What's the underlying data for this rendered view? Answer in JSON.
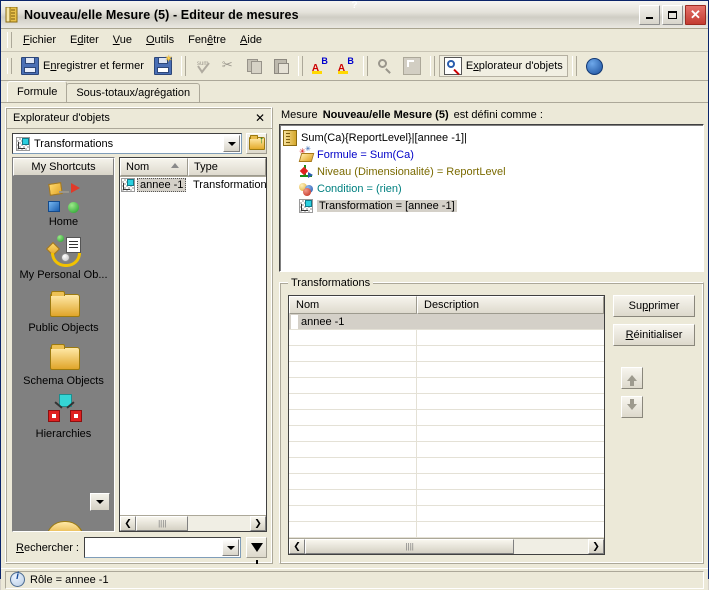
{
  "window": {
    "title": "Nouveau/elle Mesure (5) - Editeur de mesures",
    "icon": "measure-ruler-icon",
    "minimize_label": "–",
    "maximize_label": "□",
    "close_label": "✕"
  },
  "menu": {
    "items": [
      {
        "label": "Fichier",
        "accel": "F"
      },
      {
        "label": "Editer",
        "accel": "d"
      },
      {
        "label": "Vue",
        "accel": "V"
      },
      {
        "label": "Outils",
        "accel": "O"
      },
      {
        "label": "Fenêtre",
        "accel": "ê"
      },
      {
        "label": "Aide",
        "accel": "A"
      }
    ]
  },
  "toolbar": {
    "save_close_label": "Enregistrer et fermer",
    "save_close_accel": "n",
    "object_explorer_label": "Explorateur d'objets",
    "object_explorer_accel": "x",
    "icons": [
      "save-disk-icon",
      "save-as-disk-icon",
      "sum-check-icon",
      "cut-scissors-icon",
      "copy-icon",
      "paste-icon",
      "spell-check-a-icon",
      "spell-check-b-icon",
      "find-icon",
      "zoom-box-icon",
      "object-explorer-icon",
      "help-icon"
    ]
  },
  "tabs": [
    {
      "label": "Formule",
      "active": true
    },
    {
      "label": "Sous-totaux/agrégation",
      "active": false
    }
  ],
  "object_explorer": {
    "panel_title": "Explorateur d'objets",
    "close_label": "✕",
    "combo_value": "Transformations",
    "combo_icon": "transformation-icon",
    "up_button_icon": "folder-up-icon",
    "shortcuts_header": "My Shortcuts",
    "shortcuts": [
      {
        "label": "Home",
        "icon": "home-shapes-icon"
      },
      {
        "label": "My Personal Ob...",
        "icon": "personal-objects-icon"
      },
      {
        "label": "Public Objects",
        "icon": "folder-icon"
      },
      {
        "label": "Schema Objects",
        "icon": "folder-icon"
      },
      {
        "label": "Hierarchies",
        "icon": "hierarchy-icon"
      }
    ],
    "shortcuts_scroll_down": "▼",
    "list": {
      "columns": [
        "Nom",
        "Type"
      ],
      "sort_column": "Nom",
      "sort_direction": "asc",
      "rows": [
        {
          "nom": "annee -1",
          "type": "Transformation",
          "icon": "transformation-icon",
          "selected": true
        }
      ]
    },
    "scroll_left_label": "❮",
    "scroll_right_label": "❯",
    "search_label": "Rechercher :",
    "search_accel": "R",
    "search_value": "",
    "filter_icon": "funnel-filter-icon"
  },
  "measure": {
    "prefix": "Mesure",
    "name": "Nouveau/elle Mesure (5)",
    "suffix": "est défini comme :",
    "tree": {
      "root": {
        "label": "Sum(Ca){ReportLevel}|[annee -1]|",
        "icon": "measure-ruler-icon"
      },
      "children": [
        {
          "label": "Formule = Sum(Ca)",
          "icon": "formula-icon",
          "color": "#0000c8",
          "selected": false
        },
        {
          "label": "Niveau (Dimensionalité) = ReportLevel",
          "icon": "level-axes-icon",
          "color": "#7a6a00",
          "selected": false
        },
        {
          "label": "Condition = (rien)",
          "icon": "condition-spheres-icon",
          "color": "#008080",
          "selected": false
        },
        {
          "label": "Transformation = [annee -1]",
          "icon": "transformation-icon",
          "color": "#000000",
          "selected": true
        }
      ]
    }
  },
  "transformations": {
    "group_title": "Transformations",
    "columns": [
      "Nom",
      "Description"
    ],
    "rows": [
      {
        "nom": "annee -1",
        "description": "",
        "selected": true
      }
    ],
    "empty_rows": 13,
    "delete_button": "Supprimer",
    "delete_accel": "p",
    "reset_button": "Réinitialiser",
    "reset_accel": "R",
    "move_up_icon": "arrow-up-icon",
    "move_down_icon": "arrow-down-icon",
    "scroll_left_label": "❮",
    "scroll_right_label": "❯"
  },
  "statusbar": {
    "icon": "info-icon",
    "text": "Rôle = annee -1"
  },
  "colors": {
    "window_face": "#ece9d8",
    "title_border": "#0a246a",
    "selection": "#d4d0c8",
    "shortcuts_bg": "#808080",
    "formula_text": "#0000c8",
    "level_text": "#7a6a00",
    "condition_text": "#008080",
    "close_button": "#c33b31"
  }
}
